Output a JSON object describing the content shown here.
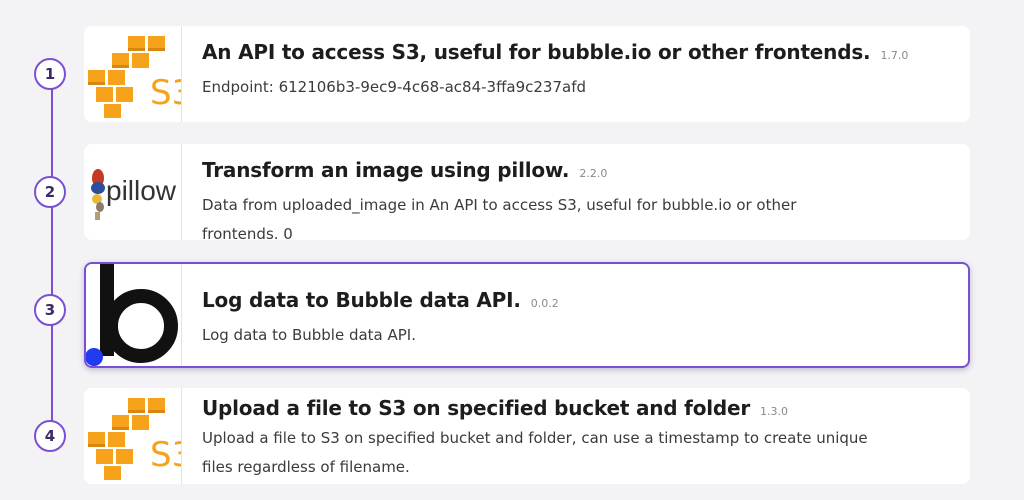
{
  "steps": [
    {
      "number": "1",
      "icon": "aws-s3-icon",
      "title": "An API to access S3, useful for bubble.io or other frontends.",
      "version": "1.7.0",
      "description": "Endpoint: 612106b3-9ec9-4c68-ac84-3ffa9c237afd",
      "selected": false
    },
    {
      "number": "2",
      "icon": "pillow-logo-icon",
      "icon_text": "pillow",
      "title": "Transform an image using pillow.",
      "version": "2.2.0",
      "description": "Data from uploaded_image in An API to access S3, useful for bubble.io or other\nfrontends. 0",
      "selected": false
    },
    {
      "number": "3",
      "icon": "bubble-logo-icon",
      "title": "Log data to Bubble data API.",
      "version": "0.0.2",
      "description": "Log data to Bubble data API.",
      "selected": true
    },
    {
      "number": "4",
      "icon": "aws-s3-icon",
      "title": "Upload a file to S3 on specified bucket and folder",
      "version": "1.3.0",
      "description": "Upload a file to S3 on specified bucket and folder, can use a timestamp to create unique\nfiles regardless of filename.",
      "selected": false
    }
  ],
  "colors": {
    "accent": "#7a4fd6",
    "s3_orange": "#f7a21b",
    "bubble_blue": "#1f3cf0",
    "background": "#f3f2f4"
  }
}
